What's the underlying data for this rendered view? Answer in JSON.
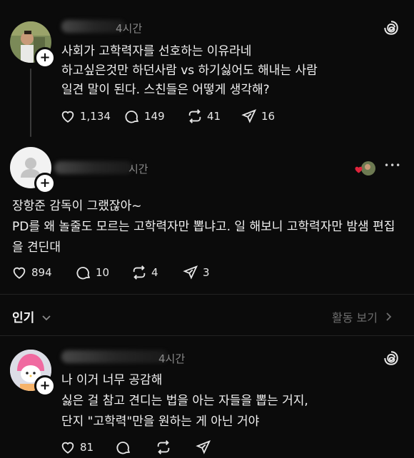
{
  "posts": [
    {
      "time": "4시간",
      "lines": [
        "사회가 고학력자를 선호하는 이유라네",
        "하고싶은것만 하던사람 vs  하기싫어도 해내는 사람",
        "일견 말이 된다. 스친들은 어떻게 생각해?"
      ],
      "likes": "1,134",
      "comments": "149",
      "reposts": "41",
      "shares": "16"
    },
    {
      "time": "시간",
      "lines": [
        "장항준 감독이 그랬잖아~",
        "PD를 왜 놀줄도 모르는 고학력자만 뽑냐고. 일 해보니 고학력자만 밤샘 편집",
        "을 견딘대"
      ],
      "likes": "894",
      "comments": "10",
      "reposts": "4",
      "shares": "3",
      "more": "•••"
    },
    {
      "time": "4시간",
      "lines": [
        "나 이거 너무 공감해",
        "싫은 걸 참고 견디는 법을 아는 자들을 뽑는 거지,",
        "단지 \"고학력\"만을 원하는 게 아닌 거야"
      ],
      "likes": "81"
    }
  ],
  "section": {
    "popular": "인기",
    "activity": "활동 보기"
  },
  "colors": {
    "background": "#0b0b0b",
    "text": "#f3f3f3",
    "muted": "#8a8a8a",
    "like_heart": "#e0243c"
  }
}
